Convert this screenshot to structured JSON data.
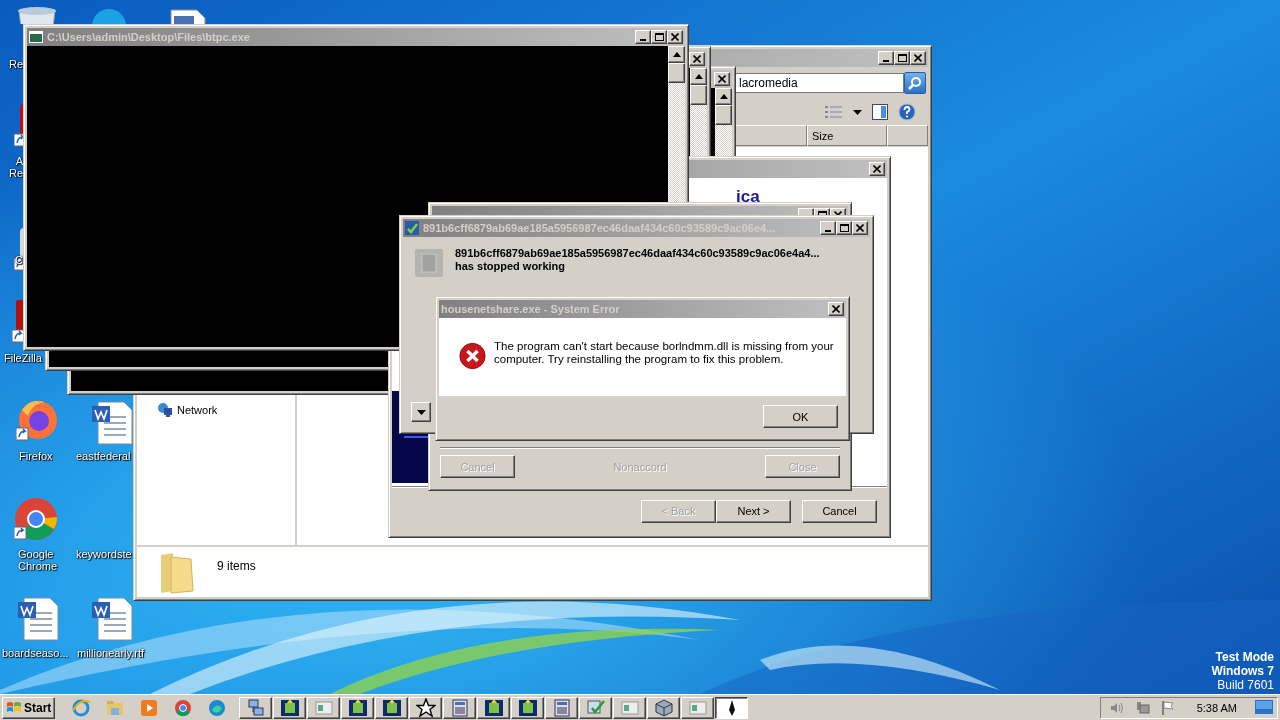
{
  "desktop": {
    "icons": [
      {
        "kind": "recycle",
        "label_lines": [
          "Re"
        ]
      },
      {
        "kind": "skype"
      },
      {
        "kind": "image-doc"
      },
      {
        "kind": "acrobat",
        "label_lines": [
          "A",
          "Re"
        ]
      },
      {
        "kind": "ccleaner",
        "label_lines": [
          "C"
        ]
      },
      {
        "kind": "filezilla",
        "label_lines": [
          "FileZilla"
        ]
      },
      {
        "kind": "firefox",
        "label_lines": [
          "Firefox"
        ]
      },
      {
        "kind": "word",
        "label_lines": [
          "eastfederal"
        ]
      },
      {
        "kind": "chrome",
        "label_lines": [
          "Google",
          "Chrome"
        ]
      },
      {
        "kind": "blank",
        "label_lines": [
          "keywordste"
        ]
      },
      {
        "kind": "word",
        "label_lines": [
          "boardseaso..."
        ]
      },
      {
        "kind": "word",
        "label_lines": [
          "millionearly.rtf"
        ]
      }
    ],
    "os_notice": [
      "Test Mode",
      "Windows 7",
      "Build 7601"
    ]
  },
  "explorer": {
    "search": {
      "value": "lacromedia"
    },
    "columns": [
      "Size"
    ],
    "nav_items": [
      "Network"
    ],
    "status": "9 items"
  },
  "back_consoles": [
    {
      "kind": "console"
    },
    {
      "kind": "console"
    }
  ],
  "installer": {
    "heading": "ica",
    "buttons": [
      {
        "label": "< Back",
        "disabled": true
      },
      {
        "label": "Next >",
        "disabled": false
      },
      {
        "label": "Cancel",
        "disabled": false
      }
    ]
  },
  "console": {
    "title": "C:\\Users\\admin\\Desktop\\Files\\btpc.exe"
  },
  "setup_progress": {
    "buttons": [
      {
        "label": "Cancel",
        "disabled": true
      },
      {
        "label": "Close",
        "disabled": true
      }
    ],
    "status": "Nonaccord"
  },
  "crash_dialog": {
    "title": "891b6cff6879ab69ae185a5956987ec46daaf434c60c93589c9ac06e4...",
    "program": "891b6cff6879ab69ae185a5956987ec46daaf434c60c93589c9ac06e4a4...",
    "message": "has stopped working"
  },
  "error_dialog": {
    "title": "housenetshare.exe - System Error",
    "message": "The program can't start because borlndmm.dll is missing from your computer. Try reinstalling the program to fix this problem.",
    "button": "OK"
  },
  "taskbar": {
    "start": "Start",
    "quick_launch": [
      {
        "kind": "ie"
      },
      {
        "kind": "folder"
      },
      {
        "kind": "media"
      },
      {
        "kind": "chrome"
      },
      {
        "kind": "edge"
      }
    ],
    "tasks": [
      {
        "kind": "network",
        "selected": false
      },
      {
        "kind": "installer",
        "selected": false
      },
      {
        "kind": "window",
        "selected": false
      },
      {
        "kind": "installer",
        "selected": false
      },
      {
        "kind": "installer",
        "selected": false
      },
      {
        "kind": "star",
        "selected": false
      },
      {
        "kind": "calculator",
        "selected": false
      },
      {
        "kind": "installer",
        "selected": false
      },
      {
        "kind": "installer",
        "selected": false
      },
      {
        "kind": "calculator",
        "selected": false
      },
      {
        "kind": "check",
        "selected": false
      },
      {
        "kind": "window",
        "selected": false
      },
      {
        "kind": "box",
        "selected": false
      },
      {
        "kind": "window",
        "selected": false
      },
      {
        "kind": "pen",
        "selected": true
      }
    ],
    "clock": "5:38 AM"
  }
}
